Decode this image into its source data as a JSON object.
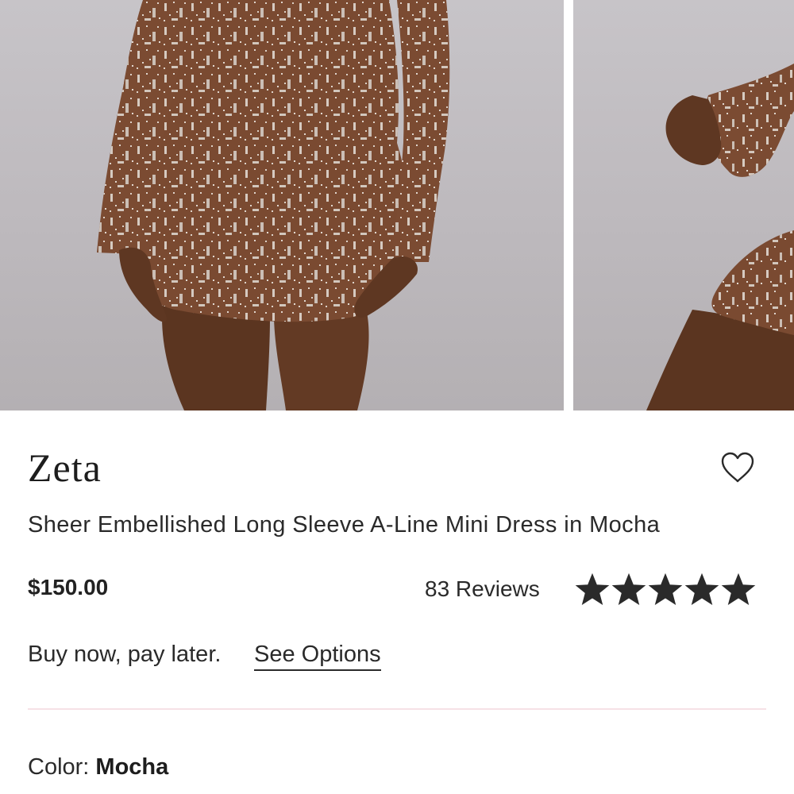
{
  "product": {
    "brand": "Zeta",
    "title": "Sheer Embellished Long Sleeve A-Line Mini Dress in Mocha",
    "price": "$150.00",
    "reviews_label": "83 Reviews",
    "rating": 5,
    "rating_max": 5
  },
  "payment": {
    "text": "Buy now, pay later.",
    "link_label": "See Options"
  },
  "color": {
    "label": "Color:",
    "value": "Mocha"
  },
  "icons": {
    "wishlist": "heart-outline-icon",
    "rating": "star-icon"
  },
  "colors": {
    "dress": "#7a4a31",
    "skin": "#6e432b",
    "background": "#c3c0c4",
    "text": "#222222",
    "divider": "#f6e1e6"
  }
}
